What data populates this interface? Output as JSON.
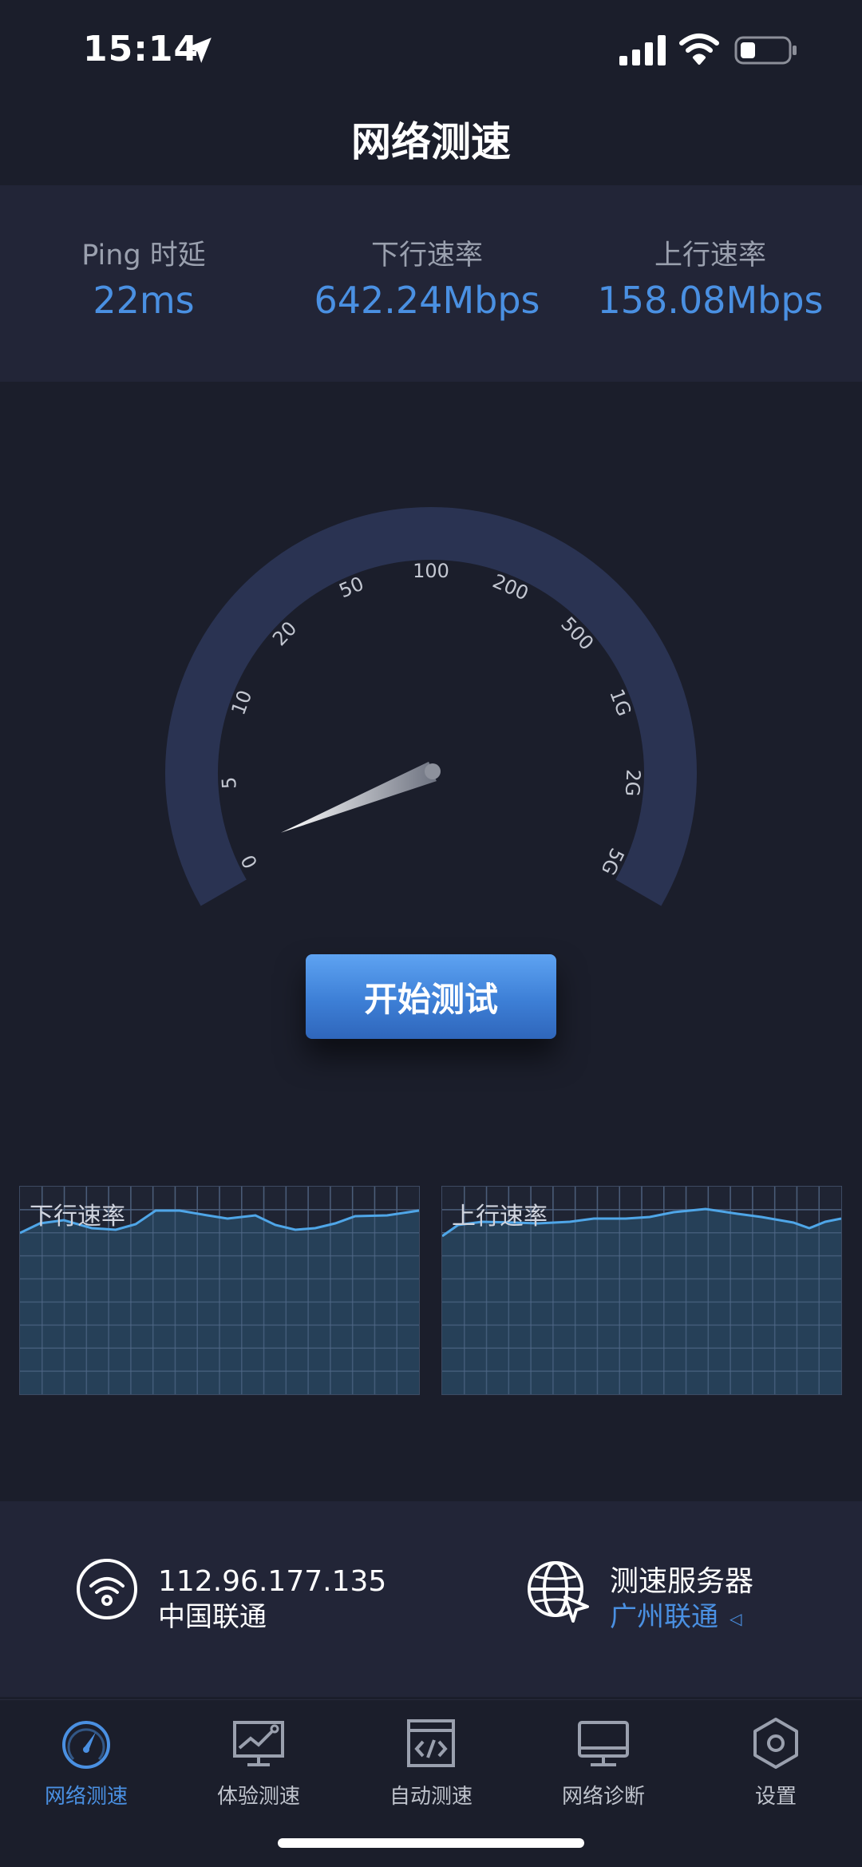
{
  "status_bar": {
    "time": "15:14",
    "icons": [
      "location-arrow-icon",
      "signal-icon",
      "wifi-icon",
      "battery-icon"
    ]
  },
  "header": {
    "title": "网络测速"
  },
  "stats": {
    "ping": {
      "label": "Ping 时延",
      "value": "22ms"
    },
    "download": {
      "label": "下行速率",
      "value": "642.24Mbps"
    },
    "upload": {
      "label": "上行速率",
      "value": "158.08Mbps"
    }
  },
  "gauge": {
    "ticks": [
      "0",
      "5",
      "10",
      "20",
      "50",
      "100",
      "200",
      "500",
      "1G",
      "2G",
      "5G"
    ],
    "needle_value": "0"
  },
  "start_button": {
    "label": "开始测试"
  },
  "charts": {
    "download": {
      "label": "下行速率"
    },
    "upload": {
      "label": "上行速率"
    }
  },
  "info": {
    "ip": "112.96.177.135",
    "isp": "中国联通",
    "server_title": "测速服务器",
    "server_name": "广州联通"
  },
  "tabs": [
    {
      "label": "网络测速",
      "icon": "speedometer-icon",
      "active": true
    },
    {
      "label": "体验测速",
      "icon": "chart-monitor-icon",
      "active": false
    },
    {
      "label": "自动测速",
      "icon": "code-window-icon",
      "active": false
    },
    {
      "label": "网络诊断",
      "icon": "monitor-icon",
      "active": false
    },
    {
      "label": "设置",
      "icon": "hexagon-gear-icon",
      "active": false
    }
  ],
  "colors": {
    "accent": "#4a90e2",
    "background": "#1b1e2b",
    "panel": "#222537",
    "gauge_arc": "#2a3352"
  }
}
